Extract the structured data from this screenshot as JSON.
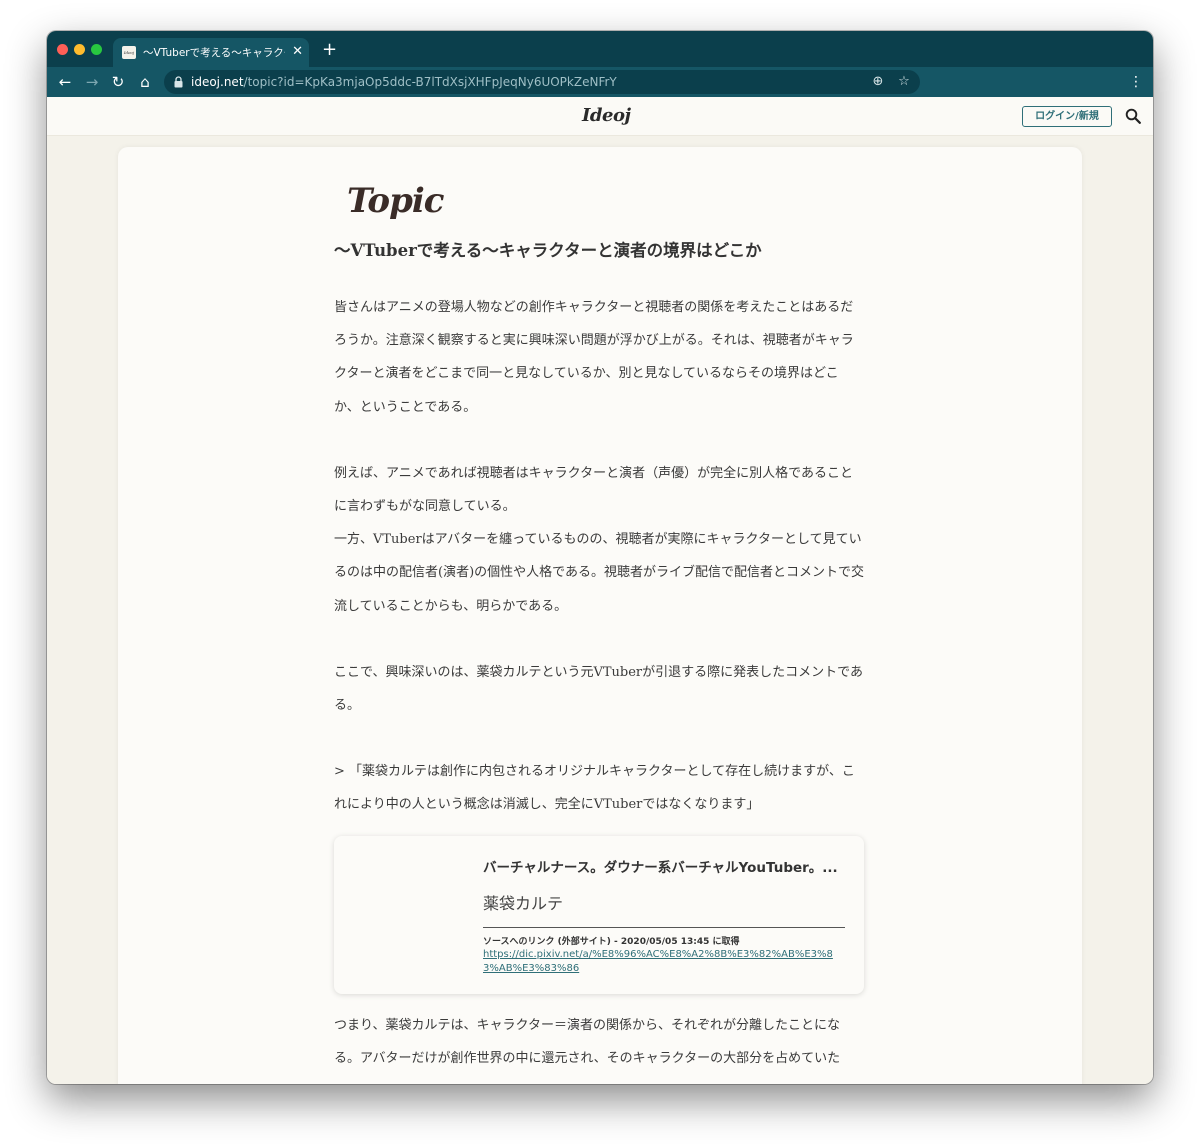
{
  "browser": {
    "tab_title": "〜VTuberで考える〜キャラクター",
    "tab_favicon_text": "Ideoj",
    "url_host": "ideoj.net",
    "url_path": "/topic?id=KpKa3mjaOp5ddc-B7lTdXsjXHFpJeqNy6UOPkZeNFrY",
    "icons": {
      "back": "←",
      "forward": "→",
      "reload": "↻",
      "home": "⌂",
      "install": "⊕",
      "star": "☆",
      "menu": "⋮",
      "close": "✕",
      "new_tab": "+"
    }
  },
  "site": {
    "logo": "Ideoj",
    "login_label": "ログイン/新規"
  },
  "topic": {
    "section_label": "Topic",
    "title": "〜VTuberで考える〜キャラクターと演者の境界はどこか",
    "paragraphs": [
      "皆さんはアニメの登場人物などの創作キャラクターと視聴者の関係を考えたことはあるだろうか。注意深く観察すると実に興味深い問題が浮かび上がる。それは、視聴者がキャラクターと演者をどこまで同一と見なしているか、別と見なしているならその境界はどこか、ということである。",
      "例えば、アニメであれば視聴者はキャラクターと演者（声優）が完全に別人格であることに言わずもがな同意している。",
      "一方、VTuberはアバターを纏っているものの、視聴者が実際にキャラクターとして見ているのは中の配信者(演者)の個性や人格である。視聴者がライブ配信で配信者とコメントで交流していることからも、明らかである。",
      "ここで、興味深いのは、薬袋カルテという元VTuberが引退する際に発表したコメントである。",
      "> 「薬袋カルテは創作に内包されるオリジナルキャラクターとして存在し続けますが、これにより中の人という概念は消滅し、完全にVTuberではなくなります」"
    ],
    "link_card": {
      "description": "バーチャルナース。ダウナー系バーチャルYouTuber。...",
      "name": "薬袋カルテ",
      "source": "ソースへのリンク (外部サイト) - 2020/05/05 13:45 に取得",
      "url": "https://dic.pixiv.net/a/%E8%96%AC%E8%A2%8B%E3%82%AB%E3%83%AB%E3%83%86"
    },
    "paragraphs_after": [
      "つまり、薬袋カルテは、キャラクター＝演者の関係から、それぞれが分離したことになる。アバターだけが創作世界の中に還元され、そのキャラクターの大部分を占めていた"
    ]
  }
}
